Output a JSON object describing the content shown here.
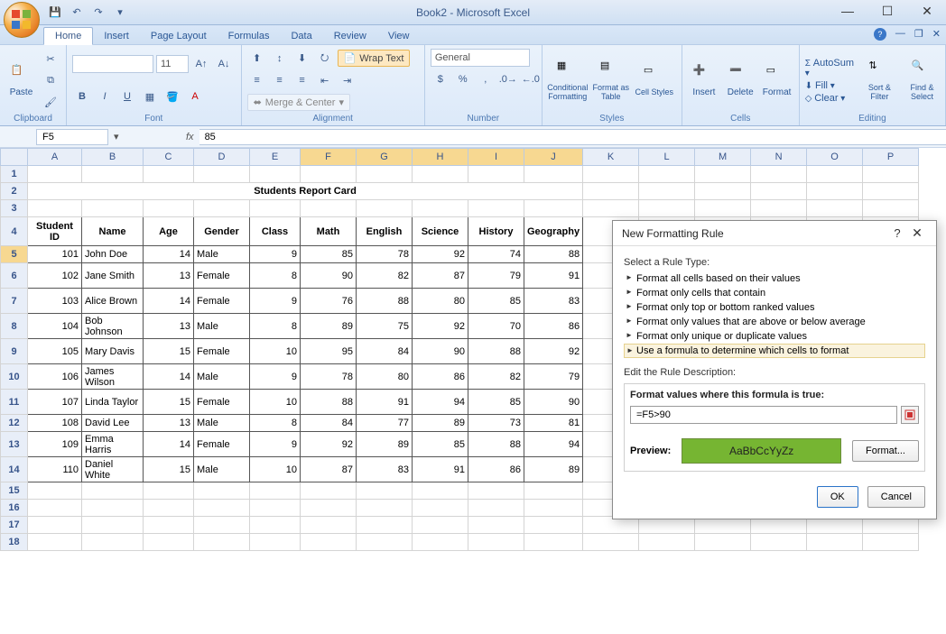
{
  "window": {
    "title": "Book2 - Microsoft Excel"
  },
  "qat": {
    "save": "save-icon",
    "undo": "undo-icon",
    "redo": "redo-icon"
  },
  "tabs": [
    "Home",
    "Insert",
    "Page Layout",
    "Formulas",
    "Data",
    "Review",
    "View"
  ],
  "active_tab": "Home",
  "ribbon": {
    "clipboard": {
      "label": "Clipboard",
      "paste": "Paste"
    },
    "font": {
      "label": "Font",
      "size": "11"
    },
    "alignment": {
      "label": "Alignment",
      "wrap": "Wrap Text",
      "merge": "Merge & Center"
    },
    "number": {
      "label": "Number",
      "format": "General"
    },
    "styles": {
      "label": "Styles",
      "cond": "Conditional Formatting",
      "table": "Format as Table",
      "cell": "Cell Styles"
    },
    "cells": {
      "label": "Cells",
      "insert": "Insert",
      "delete": "Delete",
      "format": "Format"
    },
    "editing": {
      "label": "Editing",
      "autosum": "AutoSum",
      "fill": "Fill",
      "clear": "Clear",
      "sort": "Sort & Filter",
      "find": "Find & Select"
    }
  },
  "namebox": "F5",
  "formula": "85",
  "columns": [
    "A",
    "B",
    "C",
    "D",
    "E",
    "F",
    "G",
    "H",
    "I",
    "J",
    "K",
    "L",
    "M",
    "N",
    "O",
    "P"
  ],
  "selected_cols": [
    "F",
    "G",
    "H",
    "I",
    "J"
  ],
  "selected_row": 5,
  "sheet": {
    "title_row": 2,
    "title": "Students Report Card",
    "header_row": 4,
    "headers": [
      "Student ID",
      "Name",
      "Age",
      "Gender",
      "Class",
      "Math",
      "English",
      "Science",
      "History",
      "Geography"
    ],
    "rows": [
      {
        "r": 5,
        "id": 101,
        "name": "John Doe",
        "age": 14,
        "gender": "Male",
        "class": 9,
        "math": 85,
        "english": 78,
        "science": 92,
        "history": 74,
        "geography": 88
      },
      {
        "r": 6,
        "id": 102,
        "name": "Jane Smith",
        "age": 13,
        "gender": "Female",
        "class": 8,
        "math": 90,
        "english": 82,
        "science": 87,
        "history": 79,
        "geography": 91
      },
      {
        "r": 7,
        "id": 103,
        "name": "Alice Brown",
        "age": 14,
        "gender": "Female",
        "class": 9,
        "math": 76,
        "english": 88,
        "science": 80,
        "history": 85,
        "geography": 83
      },
      {
        "r": 8,
        "id": 104,
        "name": "Bob Johnson",
        "age": 13,
        "gender": "Male",
        "class": 8,
        "math": 89,
        "english": 75,
        "science": 92,
        "history": 70,
        "geography": 86
      },
      {
        "r": 9,
        "id": 105,
        "name": "Mary Davis",
        "age": 15,
        "gender": "Female",
        "class": 10,
        "math": 95,
        "english": 84,
        "science": 90,
        "history": 88,
        "geography": 92
      },
      {
        "r": 10,
        "id": 106,
        "name": "James Wilson",
        "age": 14,
        "gender": "Male",
        "class": 9,
        "math": 78,
        "english": 80,
        "science": 86,
        "history": 82,
        "geography": 79
      },
      {
        "r": 11,
        "id": 107,
        "name": "Linda Taylor",
        "age": 15,
        "gender": "Female",
        "class": 10,
        "math": 88,
        "english": 91,
        "science": 94,
        "history": 85,
        "geography": 90
      },
      {
        "r": 12,
        "id": 108,
        "name": "David Lee",
        "age": 13,
        "gender": "Male",
        "class": 8,
        "math": 84,
        "english": 77,
        "science": 89,
        "history": 73,
        "geography": 81
      },
      {
        "r": 13,
        "id": 109,
        "name": "Emma Harris",
        "age": 14,
        "gender": "Female",
        "class": 9,
        "math": 92,
        "english": 89,
        "science": 85,
        "history": 88,
        "geography": 94
      },
      {
        "r": 14,
        "id": 110,
        "name": "Daniel White",
        "age": 15,
        "gender": "Male",
        "class": 10,
        "math": 87,
        "english": 83,
        "science": 91,
        "history": 86,
        "geography": 89
      }
    ]
  },
  "dialog": {
    "title": "New Formatting Rule",
    "select_label": "Select a Rule Type:",
    "rules": [
      "Format all cells based on their values",
      "Format only cells that contain",
      "Format only top or bottom ranked values",
      "Format only values that are above or below average",
      "Format only unique or duplicate values",
      "Use a formula to determine which cells to format"
    ],
    "selected_rule_index": 5,
    "edit_label": "Edit the Rule Description:",
    "formula_label": "Format values where this formula is true:",
    "formula_value": "=F5>90",
    "preview_label": "Preview:",
    "preview_text": "AaBbCcYyZz",
    "format_btn": "Format...",
    "ok": "OK",
    "cancel": "Cancel"
  }
}
